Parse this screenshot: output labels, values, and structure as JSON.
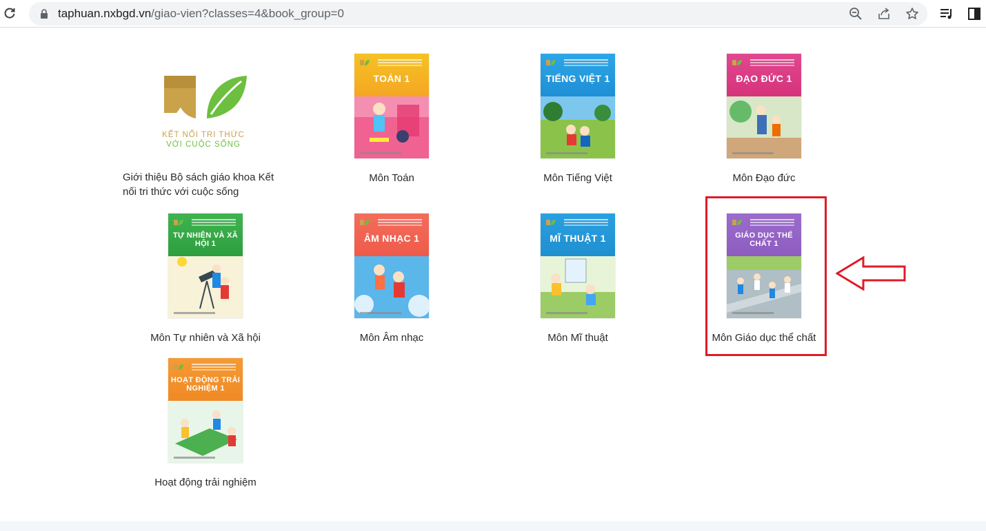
{
  "browser": {
    "url_host": "taphuan.nxbgd.vn",
    "url_path": "/giao-vien?classes=4&book_group=0"
  },
  "intro": {
    "logo_text_line1": "KẾT NỐI TRI THỨC",
    "logo_text_line2": "VỚI CUỘC SỐNG",
    "label": "Giới thiệu Bộ sách giáo khoa Kết nối tri thức với cuộc sống"
  },
  "books": [
    {
      "label": "Môn Toán",
      "cover_title": "TOÁN 1",
      "color": "#f5a623"
    },
    {
      "label": "Môn Tiếng Việt",
      "cover_title": "TIẾNG VIỆT 1",
      "color": "#1e8fd6"
    },
    {
      "label": "Môn Đạo đức",
      "cover_title": "ĐẠO ĐỨC 1",
      "color": "#d6337a"
    },
    {
      "label": "Môn Tự nhiên và Xã hội",
      "cover_title": "TỰ NHIÊN VÀ XÃ HỘI 1",
      "color": "#2e9e3f"
    },
    {
      "label": "Môn Âm nhạc",
      "cover_title": "ÂM NHẠC 1",
      "color": "#ef5a4a"
    },
    {
      "label": "Môn Mĩ thuật",
      "cover_title": "MĨ THUẬT 1",
      "color": "#1f8fd0"
    },
    {
      "label": "Môn Giáo dục thể chất",
      "cover_title": "GIÁO DỤC THỂ CHẤT 1",
      "color": "#8e5cc0"
    },
    {
      "label": "Hoạt động trải nghiệm",
      "cover_title": "HOẠT ĐỘNG TRẢI NGHIỆM 1",
      "color": "#f08a24"
    }
  ],
  "colors": {
    "highlight": "#e01b24",
    "logo_gold": "#c9a24a",
    "logo_green": "#6cbf3f"
  }
}
